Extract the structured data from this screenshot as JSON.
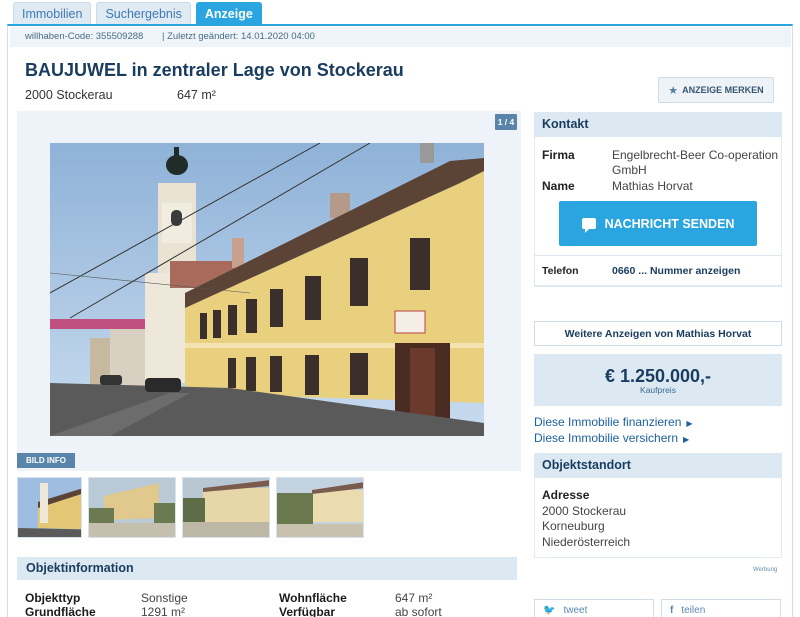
{
  "tabs": [
    {
      "label": "Immobilien"
    },
    {
      "label": "Suchergebnis"
    },
    {
      "label": "Anzeige",
      "active": true
    }
  ],
  "meta": {
    "code": "willhaben-Code: 355509288",
    "changed": "| Zuletzt geändert: 14.01.2020 04:00"
  },
  "listing": {
    "title": "BAUJUWEL in zentraler Lage von Stockerau",
    "location": "2000 Stockerau",
    "area": "647 m²"
  },
  "actions": {
    "merken": "ANZEIGE MERKEN"
  },
  "gallery": {
    "counter": "1 / 4",
    "bild_info": "BILD INFO",
    "thumbnail_count": 4
  },
  "objektinfo": {
    "heading": "Objektinformation",
    "rows": [
      {
        "label": "Objekttyp",
        "value": "Sonstige"
      },
      {
        "label": "Grundfläche",
        "value": "1291 m²"
      },
      {
        "label": "Wohnfläche",
        "value": "647 m²"
      },
      {
        "label": "Verfügbar",
        "value": "ab sofort"
      }
    ]
  },
  "contact": {
    "heading": "Kontakt",
    "firma_label": "Firma",
    "firma_line1": "Engelbrecht-Beer Co-operation",
    "firma_line2": "GmbH",
    "name_label": "Name",
    "name_value": "Mathias Horvat",
    "send_button": "NACHRICHT SENDEN",
    "phone_label": "Telefon",
    "phone_value": "0660 ... Nummer anzeigen",
    "more_ads": "Weitere Anzeigen von Mathias Horvat"
  },
  "price": {
    "amount": "€ 1.250.000,-",
    "label": "Kaufpreis"
  },
  "links": {
    "finance": "Diese Immobilie finanzieren",
    "insure": "Diese Immobilie versichern"
  },
  "standort": {
    "heading": "Objektstandort",
    "adresse_label": "Adresse",
    "line1": "2000 Stockerau",
    "line2": "Korneuburg",
    "line3": "Niederösterreich"
  },
  "ad_label": "Werbung",
  "social": {
    "tweet": "tweet",
    "teilen": "teilen"
  },
  "colors": {
    "accent": "#2aa5e0",
    "heading": "#1a3c5e",
    "panel": "#dce9f3"
  }
}
